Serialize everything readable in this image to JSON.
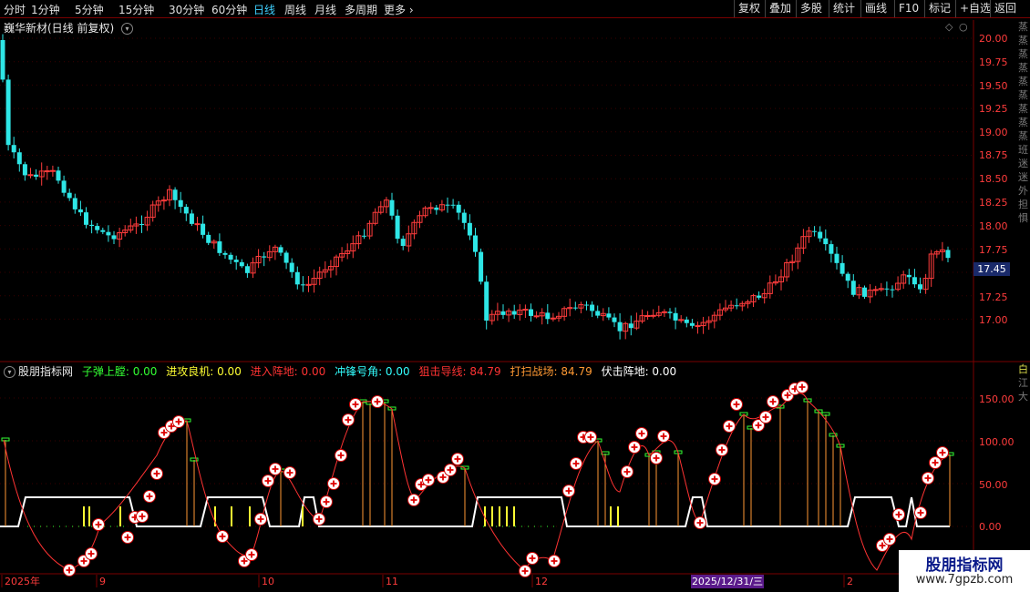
{
  "toolbar": {
    "periods": [
      "分时",
      "1分钟",
      "5分钟",
      "15分钟",
      "30分钟",
      "60分钟",
      "日线",
      "周线",
      "月线",
      "多周期",
      "更多"
    ],
    "active_period": "日线",
    "more_arrow": "chevron-right-icon",
    "right_buttons": [
      "复权",
      "叠加",
      "多股",
      "统计",
      "画线",
      "F10",
      "标记",
      "+自选",
      "返回"
    ]
  },
  "main": {
    "stock_title": "巍华新材(日线 前复权)",
    "price_axis": [
      "20.00",
      "19.75",
      "19.50",
      "19.25",
      "19.00",
      "18.75",
      "18.50",
      "18.25",
      "18.00",
      "17.75",
      "17.50",
      "17.25",
      "17.00"
    ],
    "current_price": "17.45"
  },
  "indicator": {
    "name": "股朋指标网",
    "legend": [
      {
        "label": "子弹上膛: 0.00",
        "color": "#33ff33"
      },
      {
        "label": "进攻良机: 0.00",
        "color": "#ffff33"
      },
      {
        "label": "进入阵地: 0.00",
        "color": "#ff3333"
      },
      {
        "label": "冲锋号角: 0.00",
        "color": "#33ffff"
      },
      {
        "label": "狙击导线: 84.79",
        "color": "#ff3333"
      },
      {
        "label": "打扫战场: 84.79",
        "color": "#ff9933"
      },
      {
        "label": "伏击阵地: 0.00",
        "color": "#ffffff"
      }
    ],
    "axis": [
      "150.00",
      "100.00",
      "50.00",
      "0.00"
    ]
  },
  "date_axis": {
    "labels": [
      "2025年",
      "9",
      "10",
      "11",
      "12",
      "2"
    ],
    "highlight": "2025/12/31/三"
  },
  "watermark": {
    "title": "股朋指标网",
    "url": "www.7gpzb.com"
  },
  "right_strip": [
    "蒸",
    "蒸",
    "蒸",
    "蒸",
    "蒸",
    "蒸",
    "蒸",
    "蒸",
    "蒸",
    "班",
    "迷",
    "迷",
    "外",
    "担",
    "惧"
  ],
  "right_strip_lower": [
    "白",
    "江",
    "大"
  ],
  "colors": {
    "up": "#ff3c3c",
    "down": "#2ee6e6",
    "bg": "#000000",
    "grid": "#7a0000",
    "axis_text": "#ff3c3c"
  }
}
